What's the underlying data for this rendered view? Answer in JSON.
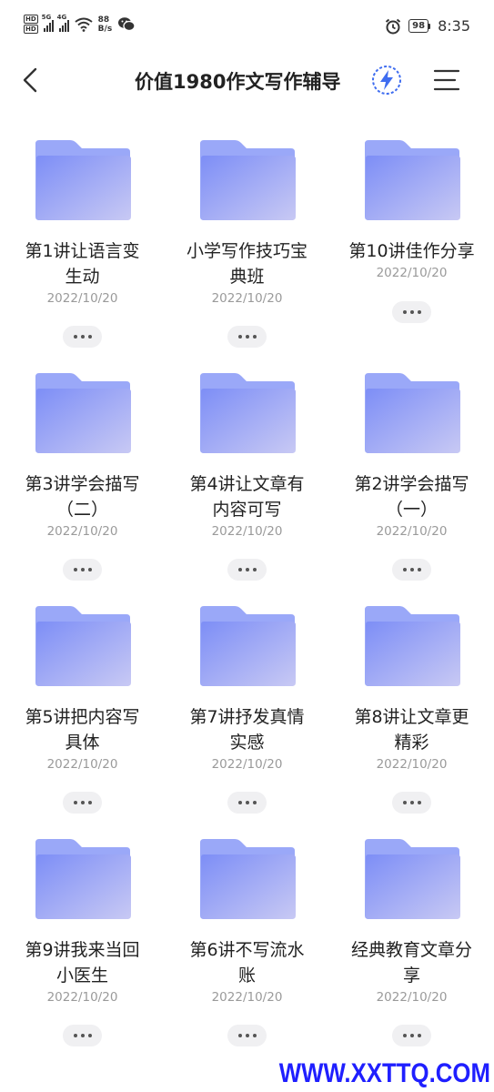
{
  "status_bar": {
    "net_speed_value": "88",
    "net_speed_unit": "B/s",
    "signal1": "5G",
    "signal2": "4G",
    "battery": "98",
    "time": "8:35",
    "icons": [
      "hd-icon",
      "signal-icon",
      "wifi-icon",
      "wechat-icon",
      "alarm-icon",
      "battery-icon"
    ]
  },
  "header": {
    "title": "价值1980作文写作辅导",
    "icons": [
      "back-arrow-icon",
      "lightning-icon",
      "menu-icon"
    ]
  },
  "folders": [
    {
      "line1": "第1讲让语言变",
      "line2": "生动",
      "date": "2022/10/20"
    },
    {
      "line1": "小学写作技巧宝",
      "line2": "典班",
      "date": "2022/10/20"
    },
    {
      "line1": "第10讲佳作分享",
      "line2": "",
      "date": "2022/10/20"
    },
    {
      "line1": "第3讲学会描写",
      "line2": "（二）",
      "date": "2022/10/20"
    },
    {
      "line1": "第4讲让文章有",
      "line2": "内容可写",
      "date": "2022/10/20"
    },
    {
      "line1": "第2讲学会描写",
      "line2": "（一）",
      "date": "2022/10/20"
    },
    {
      "line1": "第5讲把内容写",
      "line2": "具体",
      "date": "2022/10/20"
    },
    {
      "line1": "第7讲抒发真情",
      "line2": "实感",
      "date": "2022/10/20"
    },
    {
      "line1": "第8讲让文章更",
      "line2": "精彩",
      "date": "2022/10/20"
    },
    {
      "line1": "第9讲我来当回",
      "line2": "小医生",
      "date": "2022/10/20"
    },
    {
      "line1": "第6讲不写流水",
      "line2": "账",
      "date": "2022/10/20"
    },
    {
      "line1": "经典教育文章分",
      "line2": "享",
      "date": "2022/10/20"
    }
  ],
  "watermark": "WWW.XXTTQ.COM",
  "colors": {
    "folder_back": "#9aa8f8",
    "folder_front_start": "#7d8ef6",
    "folder_front_end": "#c8c9f4",
    "accent": "#3f6df0",
    "watermark": "#1f1fff"
  }
}
